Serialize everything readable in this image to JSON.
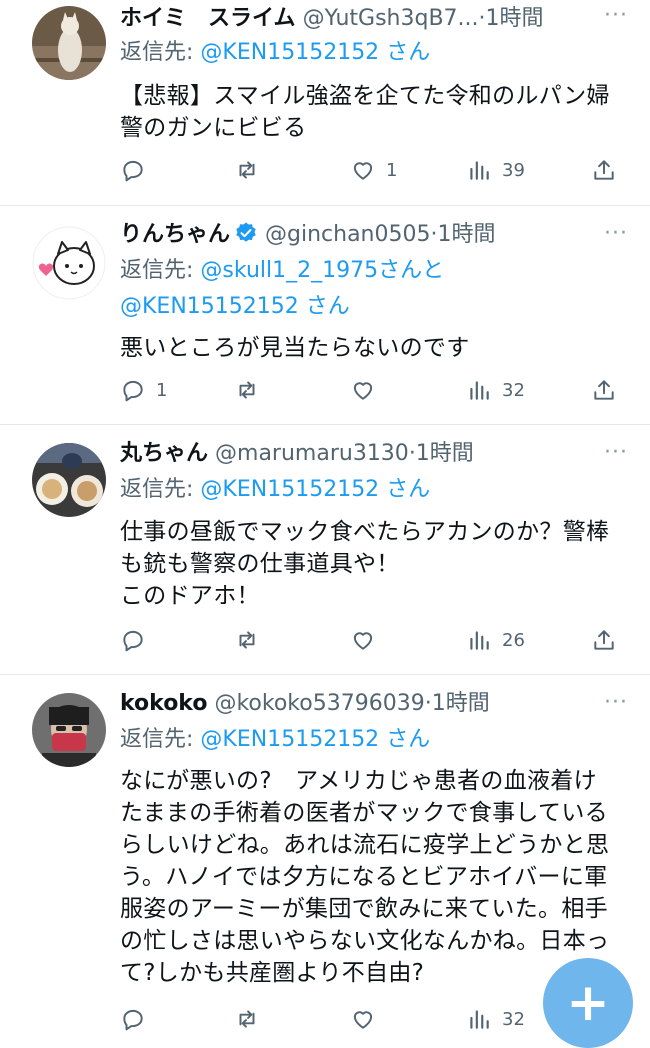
{
  "tweets": [
    {
      "name": "ホイミ　スライム",
      "handle": "@YutGsh3qB7...",
      "time": "·1時間",
      "reply_prefix": "返信先:",
      "reply_line1": "@KEN15152152",
      "reply_suffix1": "さん",
      "reply_line2": "",
      "reply_suffix2": "",
      "text": "【悲報】スマイル強盗を企てた令和のルパン婦\n警のガンにビビる",
      "reply_count": "",
      "retweet_count": "",
      "like_count": "1",
      "view_count": "39"
    },
    {
      "name": "りんちゃん",
      "handle": "@ginchan0505",
      "time": "·1時間",
      "reply_prefix": "返信先:",
      "reply_line1": "@skull1_2_1975",
      "reply_suffix1": "さんと",
      "reply_line2": "@KEN15152152",
      "reply_suffix2": "さん",
      "text": "悪いところが見当たらないのです",
      "reply_count": "1",
      "retweet_count": "",
      "like_count": "",
      "view_count": "32"
    },
    {
      "name": "丸ちゃん",
      "handle": "@marumaru3130",
      "time": "·1時間",
      "reply_prefix": "返信先:",
      "reply_line1": "@KEN15152152",
      "reply_suffix1": "さん",
      "reply_line2": "",
      "reply_suffix2": "",
      "text": "仕事の昼飯でマック食べたらアカンのか？警棒\nも銃も警察の仕事道具や！\nこのドアホ！",
      "reply_count": "",
      "retweet_count": "",
      "like_count": "",
      "view_count": "26"
    },
    {
      "name": "kokoko",
      "handle": "@kokoko53796039",
      "time": "·1時間",
      "reply_prefix": "返信先:",
      "reply_line1": "@KEN15152152",
      "reply_suffix1": "さん",
      "reply_line2": "",
      "reply_suffix2": "",
      "text": "なにが悪いの?　アメリカじゃ患者の血液着け\nたままの手術着の医者がマックで食事している\nらしいけどね。あれは流石に疫学上どうかと思\nう。ハノイでは夕方になるとビアホイバーに軍\n服姿のアーミーが集団で飲みに来ていた。相手\nの忙しさは思いやらない文化なんかね。日本っ\nて?しかも共産圏より不自由?",
      "reply_count": "",
      "retweet_count": "",
      "like_count": "",
      "view_count": "32"
    }
  ],
  "icons": {
    "reply": "reply-icon",
    "retweet": "retweet-icon",
    "like": "like-icon",
    "views": "views-icon",
    "share": "share-icon",
    "more": "more-icon",
    "verified": "verified-icon",
    "compose": "compose-icon"
  },
  "fab_label": "+",
  "more_label": "···",
  "colors": {
    "link": "#1d9bf0",
    "secondary": "#536471",
    "fab": "#6fb6ec"
  }
}
